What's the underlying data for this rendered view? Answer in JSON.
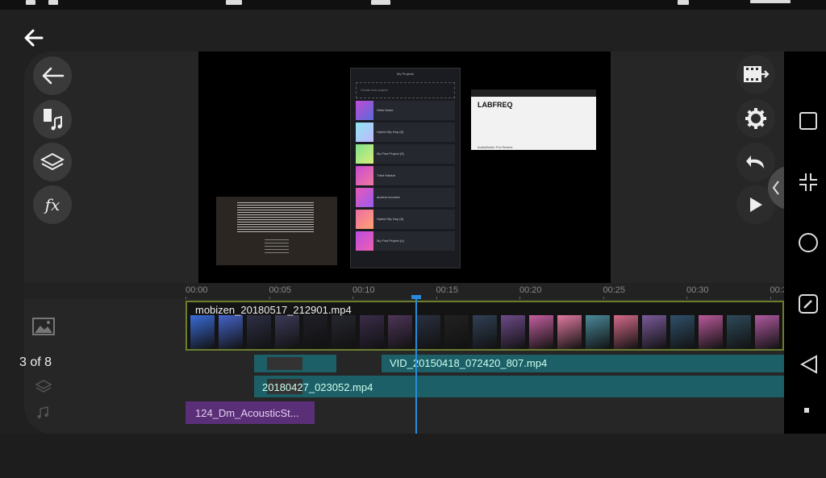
{
  "viewer": {
    "counter": "3 of 8"
  },
  "colors": {
    "accent": "#2a8ad8",
    "clip_border": "#6b7d2e",
    "overlay_track": "#1c5f66",
    "music_track": "#5a2f78"
  },
  "left_toolbar": [
    {
      "icon": "arrow-left-icon",
      "label": "Back"
    },
    {
      "icon": "media-music-icon",
      "label": "Media"
    },
    {
      "icon": "layers-icon",
      "label": "Layer"
    },
    {
      "icon": "fx-icon",
      "label": "fx"
    }
  ],
  "right_toolbar": [
    {
      "icon": "export-icon",
      "label": "Export"
    },
    {
      "icon": "gear-icon",
      "label": "Settings"
    },
    {
      "icon": "undo-icon",
      "label": "Undo"
    },
    {
      "icon": "play-icon",
      "label": "Play"
    }
  ],
  "preview": {
    "app_header": "My Projects",
    "new_project": "Create new project",
    "projects": [
      "Hello Noise",
      "Hybrid Hip Hop (6)",
      "My First Project (5)",
      "Third Habkot",
      "ancient recorder",
      "Hybrid Hip Hop (5)",
      "My First Project (4)"
    ],
    "site_logo": "LABFREQ",
    "site_footer": "AudioBuster Pro Review"
  },
  "timeline": {
    "ticks": [
      "00:00",
      "00:05",
      "00:10",
      "00:15",
      "00:20",
      "00:25",
      "00:30",
      "00:3"
    ],
    "main_clip": "mobizen_20180517_212901.mp4",
    "overlay_clip_1": "VID_20150418_072420_807.mp4",
    "overlay_clip_2": "20180427_023052.mp4",
    "music_clip": "124_Dm_AcousticSt..."
  },
  "nav": [
    "square-icon",
    "collapse-icon",
    "circle-icon",
    "edit-icon",
    "triangle-back-icon",
    "dot-icon"
  ]
}
